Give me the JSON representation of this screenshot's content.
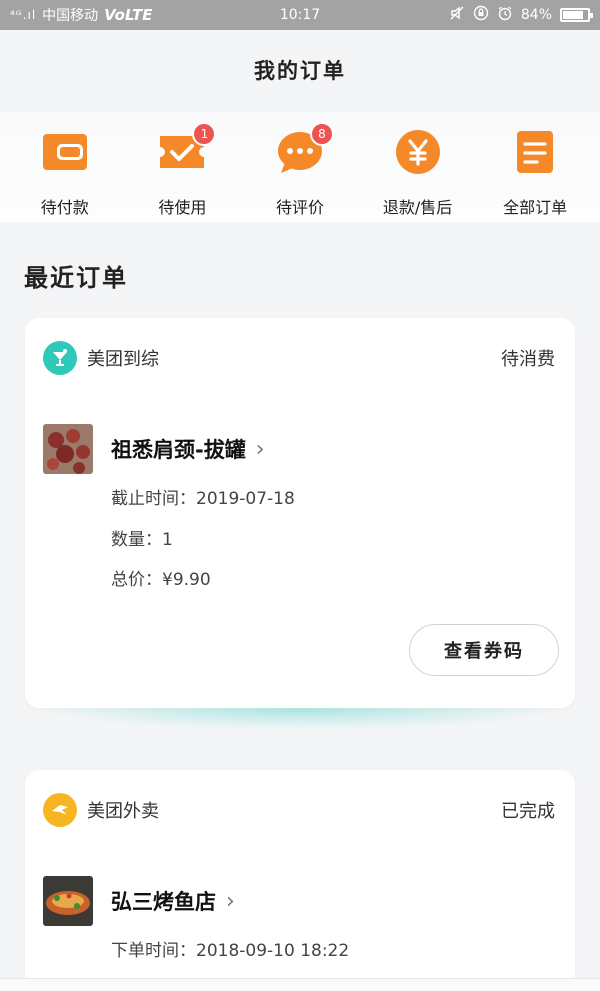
{
  "status_bar": {
    "signal": "⁴ᴳ.ıl",
    "carrier": "中国移动",
    "volte": "VoLTE",
    "time": "10:17",
    "battery_text": "84%",
    "battery_level": 0.84
  },
  "header": {
    "title": "我的订单"
  },
  "quick_actions": [
    {
      "label": "待付款",
      "icon": "wallet-icon"
    },
    {
      "label": "待使用",
      "icon": "ticket-icon",
      "badge": "1"
    },
    {
      "label": "待评价",
      "icon": "chat-bubble-icon",
      "badge": "8"
    },
    {
      "label": "退款/售后",
      "icon": "yen-icon"
    },
    {
      "label": "全部订单",
      "icon": "document-icon"
    }
  ],
  "recent": {
    "title": "最近订单",
    "orders": [
      {
        "brand": "美团到综",
        "status": "待消费",
        "item_title": "祖悉肩颈-拔罐",
        "lines": [
          "截止时间：2019-07-18",
          "数量：1",
          "总价：¥9.90"
        ],
        "button": "查看券码"
      },
      {
        "brand": "美团外卖",
        "status": "已完成",
        "item_title": "弘三烤鱼店",
        "lines": [
          "下单时间：2018-09-10 18:22"
        ]
      }
    ]
  },
  "colors": {
    "accent": "#f5892a",
    "teal": "#2ec9b8",
    "yellow": "#f7b521",
    "badge": "#ef5350"
  }
}
